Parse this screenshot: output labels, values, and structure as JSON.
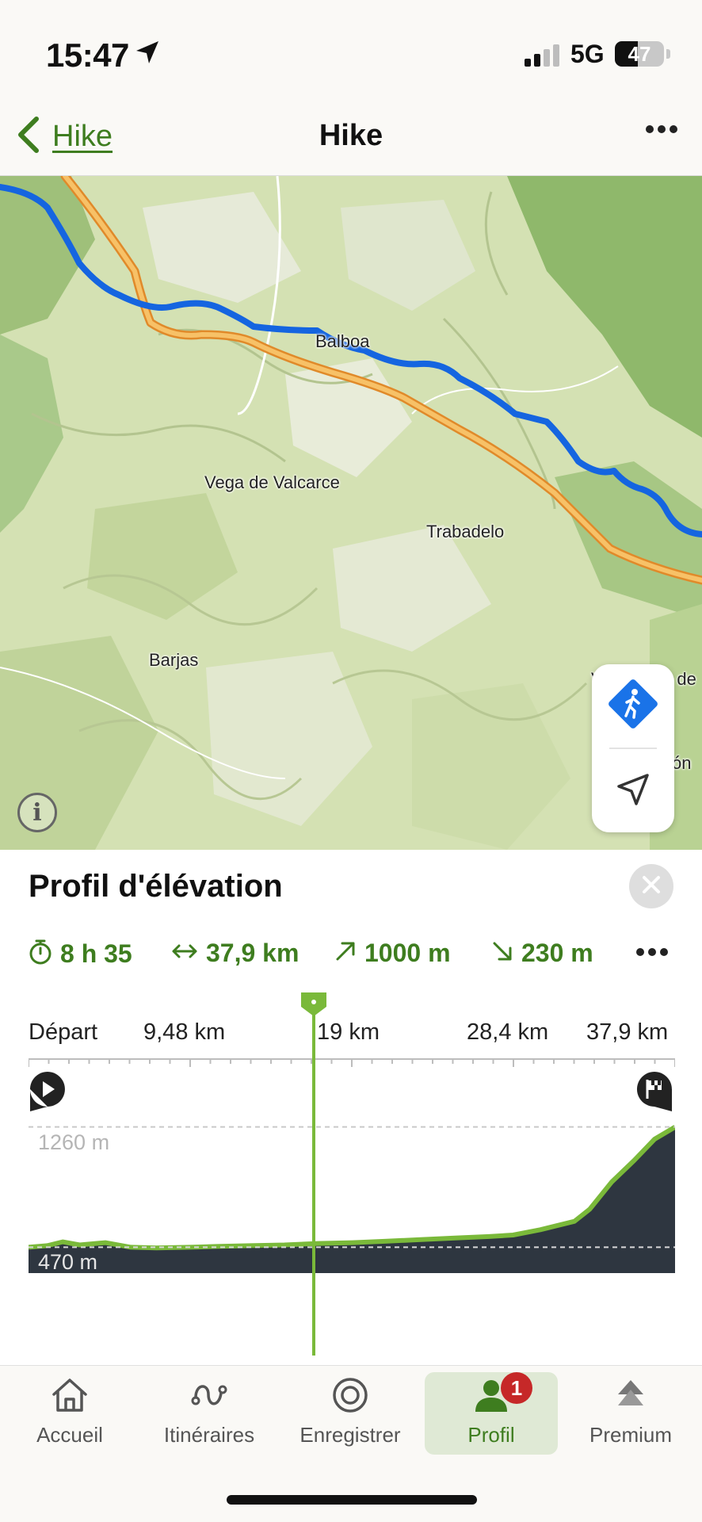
{
  "status_bar": {
    "time": "15:47",
    "network": "5G",
    "battery": "47",
    "battery_level": 0.47
  },
  "nav": {
    "back_label": "Hike",
    "title": "Hike"
  },
  "map": {
    "places": [
      "Balboa",
      "Vega de Valcarce",
      "Trabadelo",
      "Barjas",
      "Villafranca de",
      "ón"
    ],
    "route_color": "#1565e0",
    "road_color": "#f0a63c"
  },
  "elevation": {
    "title": "Profil d'élévation",
    "stats": {
      "duration": "8 h 35",
      "distance": "37,9 km",
      "ascent": "1000 m",
      "descent": "230 m"
    },
    "axis_labels": [
      "Départ",
      "9,48 km",
      "19 km",
      "28,4 km",
      "37,9 km"
    ],
    "max_label": "1260 m",
    "min_label": "470 m",
    "scrubber_position_km": 16.7,
    "accent_color": "#7ab93a",
    "fill_color": "#2e3640"
  },
  "chart_data": {
    "type": "area",
    "xlabel": "",
    "ylabel": "",
    "x": [
      0,
      1.1,
      2,
      3,
      4.5,
      6,
      7.5,
      9.48,
      11,
      13,
      15,
      17,
      19,
      21,
      23,
      25,
      27,
      28.4,
      30,
      32,
      32.9,
      34.2,
      35.5,
      36.7,
      37.9
    ],
    "values": [
      470,
      480,
      505,
      485,
      500,
      470,
      465,
      470,
      475,
      480,
      485,
      495,
      500,
      510,
      520,
      530,
      540,
      550,
      585,
      640,
      720,
      900,
      1040,
      1180,
      1260
    ],
    "xlim": [
      0,
      37.9
    ],
    "ylim": [
      300,
      1300
    ],
    "reference_lines": [
      1260,
      470
    ]
  },
  "tabs": [
    {
      "label": "Accueil",
      "icon": "home-icon"
    },
    {
      "label": "Itinéraires",
      "icon": "route-icon"
    },
    {
      "label": "Enregistrer",
      "icon": "record-icon"
    },
    {
      "label": "Profil",
      "icon": "profile-icon",
      "badge": "1",
      "active": true
    },
    {
      "label": "Premium",
      "icon": "premium-icon"
    }
  ]
}
